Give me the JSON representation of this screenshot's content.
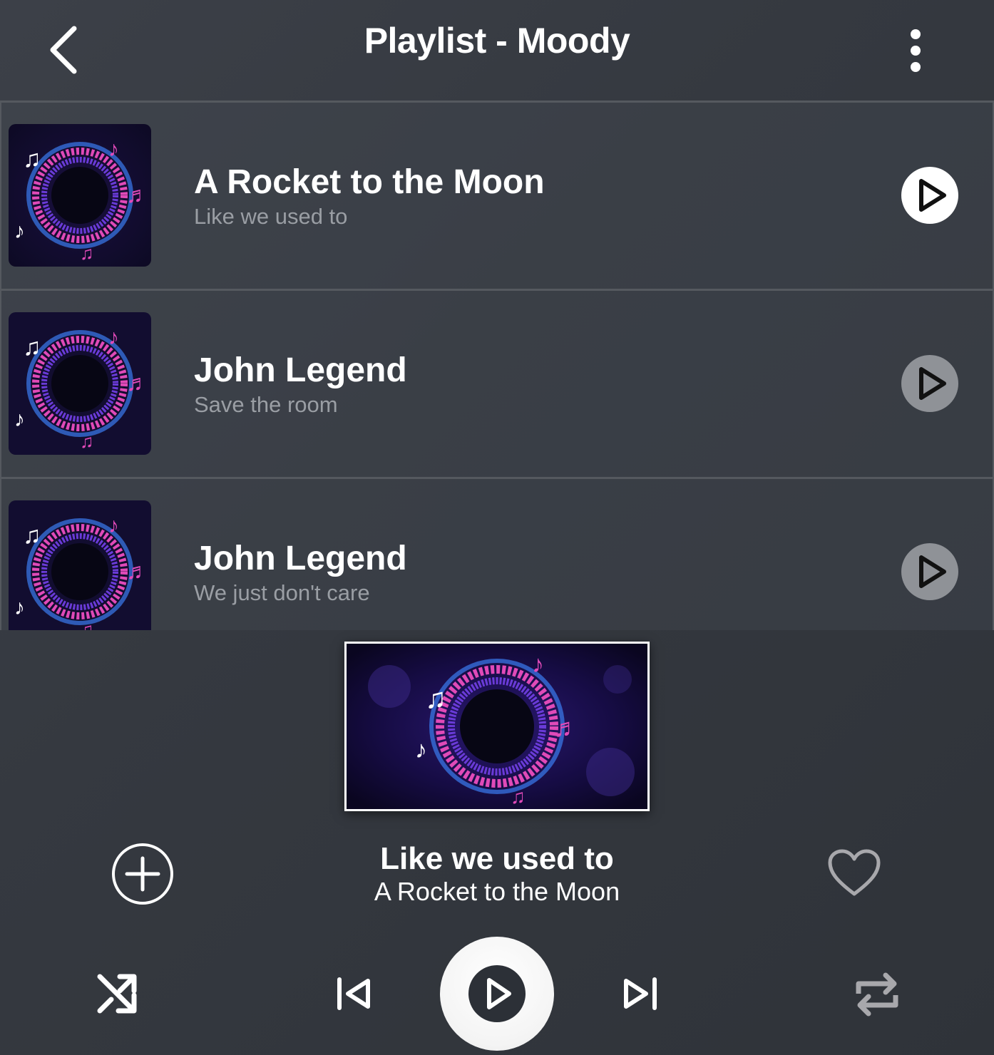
{
  "header": {
    "title": "Playlist - Moody",
    "back_icon": "chevron-left-icon",
    "menu_icon": "more-vertical-icon"
  },
  "playlist": {
    "items": [
      {
        "title": "A Rocket to the Moon",
        "subtitle": "Like we used to",
        "active": true
      },
      {
        "title": "John Legend",
        "subtitle": "Save the room",
        "active": false
      },
      {
        "title": "John Legend",
        "subtitle": "We just don't care",
        "active": false
      }
    ]
  },
  "now_playing": {
    "song": "Like we used to",
    "artist": "A Rocket to the Moon"
  },
  "controls": {
    "add_icon": "add-circle-icon",
    "like_icon": "heart-icon",
    "shuffle_icon": "shuffle-icon",
    "prev_icon": "skip-previous-icon",
    "play_icon": "play-icon",
    "next_icon": "skip-next-icon",
    "repeat_icon": "repeat-icon"
  },
  "colors": {
    "background": "#383c43",
    "text_primary": "#ffffff",
    "text_secondary": "#9a9ea4",
    "inactive_button": "#8f9297",
    "art_pink": "#e04ab8",
    "art_purple": "#6a3bd8",
    "art_blue": "#3a7cf0"
  }
}
